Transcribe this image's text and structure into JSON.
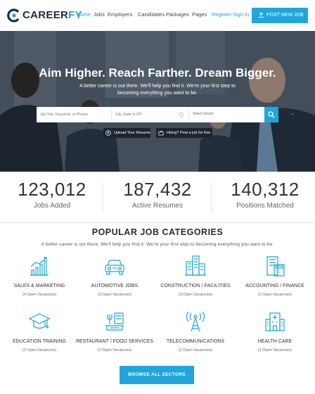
{
  "brand": {
    "prefix": "CAREER",
    "suffix": "FY",
    "accent": "#1aa3d4"
  },
  "nav": {
    "items": [
      "Home",
      "Jobs",
      "Employers",
      "Candidates",
      "Packages",
      "Pages"
    ],
    "register": "Register",
    "signin": "Sign In",
    "post_job": "POST NEW JOB"
  },
  "hero": {
    "title": "Aim Higher. Reach Farther. Dream Bigger.",
    "subtitle": "A better career is out there. We'll help you find it. We're your first step to becoming everything you want to be.",
    "search": {
      "keywords_placeholder": "Job Title, Keywords, or Phrase",
      "location_placeholder": "City, State or ZIP",
      "sector": "Select Sector"
    },
    "upload_resume": "Upload Your Resume",
    "post_job": "Hiring? Post a job for free"
  },
  "stats": [
    {
      "value": "123,012",
      "label": "Jobs Added"
    },
    {
      "value": "187,432",
      "label": "Active Resumes"
    },
    {
      "value": "140,312",
      "label": "Positions Matched"
    }
  ],
  "categories": {
    "title": "POPULAR JOB CATEGORIES",
    "subtitle": "A better career is out there. We'll help you find it. We're your first step to becoming everything you want to be.",
    "items": [
      {
        "name": "SALES & MARKETING",
        "count": "(4 Open Vacancies)",
        "icon": "chart-icon"
      },
      {
        "name": "AUTOMOTIVE JOBS",
        "count": "(3 Open Vacancies)",
        "icon": "car-icon"
      },
      {
        "name": "CONSTRUCTION / FACILITIES",
        "count": "(3 Open Vacancies)",
        "icon": "building-icon"
      },
      {
        "name": "ACCOUNTING / FINANCE",
        "count": "(2 Open Vacancies)",
        "icon": "calculator-icon"
      },
      {
        "name": "EDUCATION TRAINING",
        "count": "(2 Open Vacancies)",
        "icon": "graduation-cap-icon"
      },
      {
        "name": "RESTAURANT / FOOD SERVICES",
        "count": "(2 Open Vacancies)",
        "icon": "food-icon"
      },
      {
        "name": "TELECOMMUNICATIONS",
        "count": "(2 Open Vacancies)",
        "icon": "antenna-icon"
      },
      {
        "name": "HEALTH CARE",
        "count": "(1 Open Vacancies)",
        "icon": "hospital-icon"
      }
    ],
    "browse": "BROWSE ALL SECTORS"
  }
}
